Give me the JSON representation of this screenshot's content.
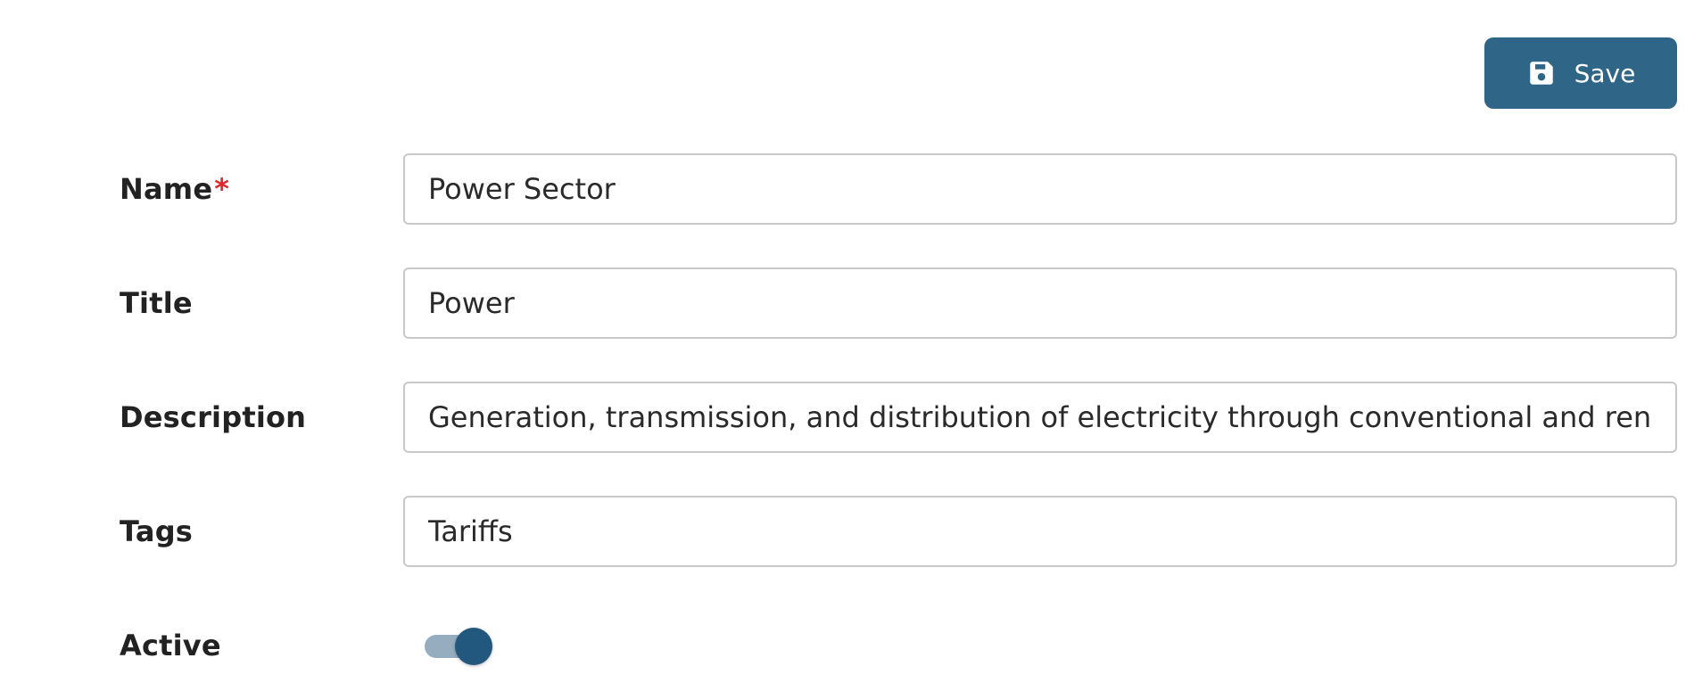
{
  "toolbar": {
    "save_label": "Save",
    "save_icon": "floppy-disk-icon",
    "accent_color": "#2f6586"
  },
  "form": {
    "name": {
      "label": "Name",
      "required_marker": "*",
      "value": "Power Sector"
    },
    "title": {
      "label": "Title",
      "value": "Power"
    },
    "description": {
      "label": "Description",
      "value": "Generation, transmission, and distribution of electricity through conventional and renewable sources"
    },
    "tags": {
      "label": "Tags",
      "value": "Tariffs"
    },
    "active": {
      "label": "Active",
      "checked": true
    }
  }
}
